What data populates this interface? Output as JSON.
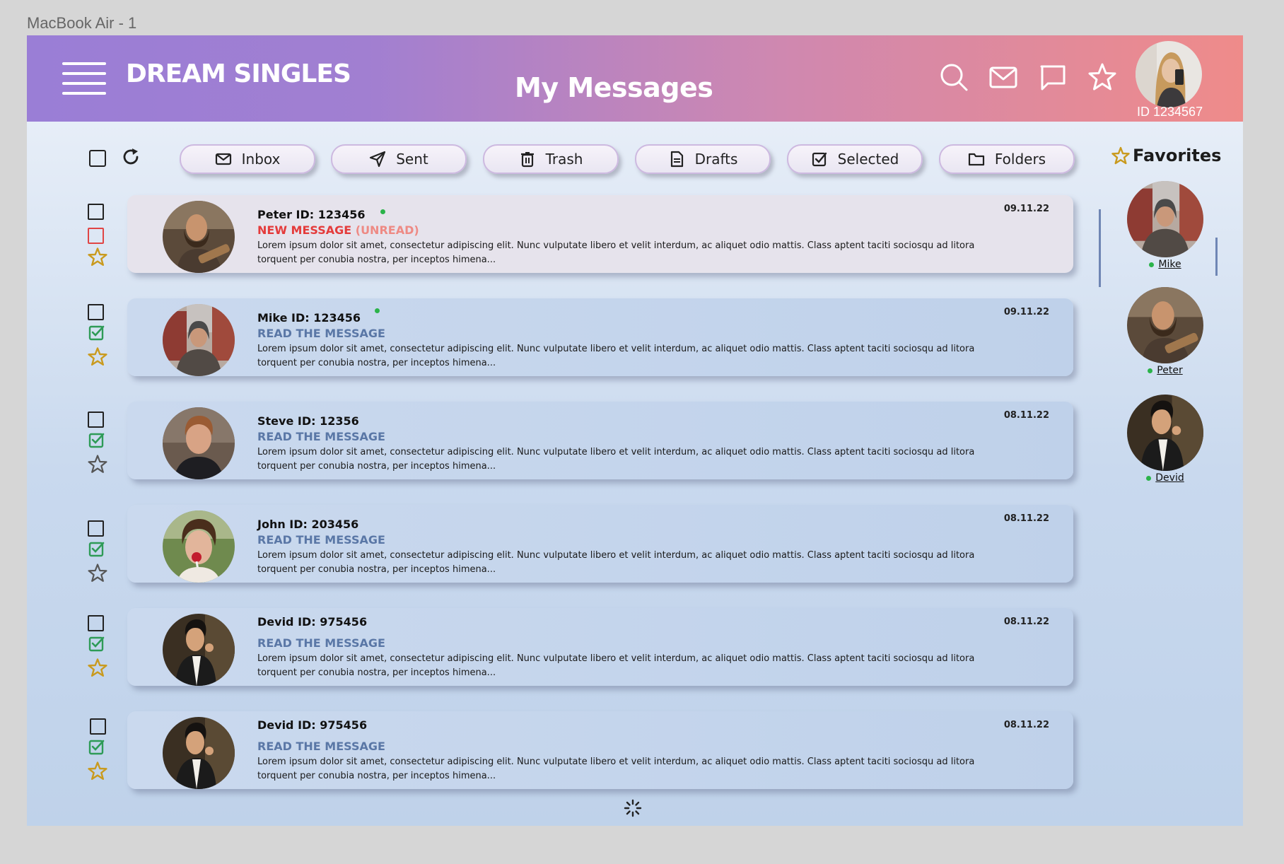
{
  "frame_label": "MacBook Air - 1",
  "header": {
    "brand": "DREAM SINGLES",
    "title": "My Messages",
    "user_id": "ID 1234567",
    "icons": [
      "search-icon",
      "mail-icon",
      "chat-icon",
      "star-icon"
    ]
  },
  "toolbar": {
    "tabs": [
      {
        "label": "Inbox",
        "icon": "envelope-icon"
      },
      {
        "label": "Sent",
        "icon": "send-icon"
      },
      {
        "label": "Trash",
        "icon": "trash-icon"
      },
      {
        "label": "Drafts",
        "icon": "document-icon"
      },
      {
        "label": "Selected",
        "icon": "checkbox-icon"
      },
      {
        "label": "Folders",
        "icon": "folder-icon"
      }
    ]
  },
  "favorites": {
    "title": "Favorites",
    "items": [
      {
        "name": "Mike",
        "online": true
      },
      {
        "name": "Peter",
        "online": true
      },
      {
        "name": "Devid",
        "online": true
      }
    ]
  },
  "messages": [
    {
      "name": "Peter ID: 123456",
      "online": true,
      "status_new": "NEW MESSAGE",
      "status_unread": "(UNREAD)",
      "status": "",
      "date": "09.11.22",
      "unread": true,
      "starred": true,
      "body": "Lorem ipsum dolor sit amet, consectetur adipiscing elit. Nunc vulputate libero et velit interdum, ac aliquet odio mattis. Class aptent taciti sociosqu ad litora torquent per conubia nostra, per inceptos himena..."
    },
    {
      "name": "Mike ID: 123456",
      "online": true,
      "status": "READ THE MESSAGE",
      "date": "09.11.22",
      "unread": false,
      "starred": true,
      "body": "Lorem ipsum dolor sit amet, consectetur adipiscing elit. Nunc vulputate libero et velit interdum, ac aliquet odio mattis. Class aptent taciti sociosqu ad litora torquent per conubia nostra, per inceptos himena..."
    },
    {
      "name": "Steve ID: 12356",
      "online": false,
      "status": "READ THE MESSAGE",
      "date": "08.11.22",
      "unread": false,
      "starred": false,
      "body": "Lorem ipsum dolor sit amet, consectetur adipiscing elit. Nunc vulputate libero et velit interdum, ac aliquet odio mattis. Class aptent taciti sociosqu ad litora torquent per conubia nostra, per inceptos himena..."
    },
    {
      "name": "John ID: 203456",
      "online": false,
      "status": "READ THE MESSAGE",
      "date": "08.11.22",
      "unread": false,
      "starred": false,
      "body": "Lorem ipsum dolor sit amet, consectetur adipiscing elit. Nunc vulputate libero et velit interdum, ac aliquet odio mattis. Class aptent taciti sociosqu ad litora torquent per conubia nostra, per inceptos himena..."
    },
    {
      "name": "Devid ID: 975456",
      "online": false,
      "status": "READ THE MESSAGE",
      "date": "08.11.22",
      "unread": false,
      "starred": true,
      "body": "Lorem ipsum dolor sit amet, consectetur adipiscing elit. Nunc vulputate libero et velit interdum, ac aliquet odio mattis. Class aptent taciti sociosqu ad litora torquent per conubia nostra, per inceptos himena..."
    },
    {
      "name": "Devid  ID: 975456",
      "online": false,
      "status": "READ THE MESSAGE",
      "date": "08.11.22",
      "unread": false,
      "starred": true,
      "body": "Lorem ipsum dolor sit amet, consectetur adipiscing elit. Nunc vulputate libero et velit interdum, ac aliquet odio mattis. Class aptent taciti sociosqu ad litora torquent per conubia nostra, per inceptos himena..."
    }
  ],
  "colors": {
    "header_gradient_start": "#9a7ed6",
    "header_gradient_end": "#ef8b8a",
    "status_read": "#5a77a6",
    "status_new": "#e43b3b",
    "online_dot": "#2bb34a",
    "star_gold": "#c99a1e"
  }
}
